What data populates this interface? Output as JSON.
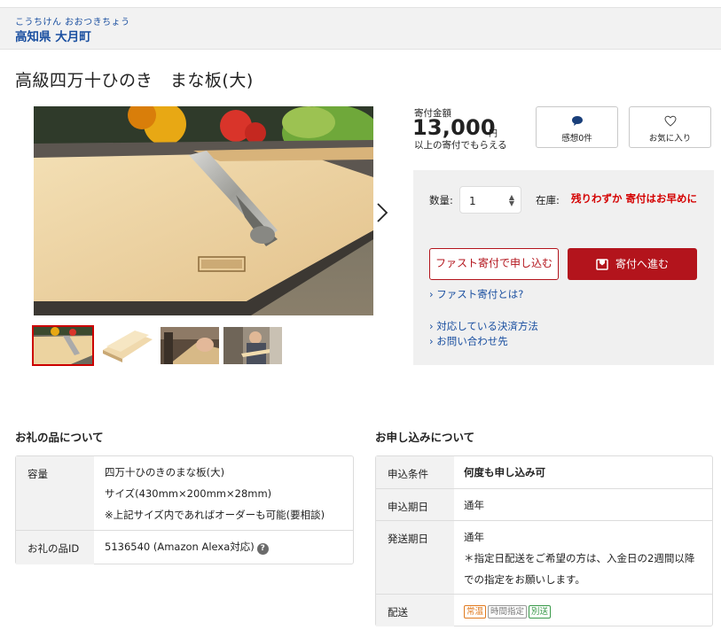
{
  "municipality": {
    "kana": "こうちけん おおつきちょう",
    "name": "高知県 大月町"
  },
  "product": {
    "title": "高級四万十ひのき　まな板(大)"
  },
  "price": {
    "label": "寄付金額",
    "amount": "13,000",
    "unit": "円",
    "note": "以上の寄付でもらえる"
  },
  "actions": {
    "thanks_label": "感想0件",
    "favorite_label": "お気に入り"
  },
  "order": {
    "qty_label": "数量:",
    "qty_value": "1",
    "stock_label": "在庫:",
    "stock_value": "残りわずか 寄付はお早めに",
    "fast_button": "ファスト寄付で申し込む",
    "donate_button": "寄付へ進む",
    "link_fast": "ファスト寄付とは?",
    "link_payment": "対応している決済方法",
    "link_contact": "お問い合わせ先"
  },
  "gift_section": {
    "title": "お礼の品について",
    "rows": [
      {
        "label": "容量",
        "lines": [
          "四万十ひのきのまな板(大)",
          "サイズ(430mm×200mm×28mm)",
          "※上記サイズ内であればオーダーも可能(要相談)"
        ]
      },
      {
        "label": "お礼の品ID",
        "value": "5136540 (Amazon Alexa対応)"
      }
    ]
  },
  "apply_section": {
    "title": "お申し込みについて",
    "rows": [
      {
        "label": "申込条件",
        "value": "何度も申し込み可"
      },
      {
        "label": "申込期日",
        "value": "通年"
      },
      {
        "label": "発送期日",
        "lines": [
          "通年",
          "＊指定日配送をご希望の方は、入金日の2週間以降",
          "での指定をお願いします。"
        ]
      },
      {
        "label": "配送",
        "tags": [
          "常温",
          "時間指定",
          "別送"
        ]
      }
    ]
  },
  "colors": {
    "accent": "#b3141c",
    "link": "#1a4fa0",
    "stock": "#d40000",
    "tag_normal": "#e07a1f",
    "tag_time": "#777777",
    "tag_separate": "#3a9a4a"
  }
}
